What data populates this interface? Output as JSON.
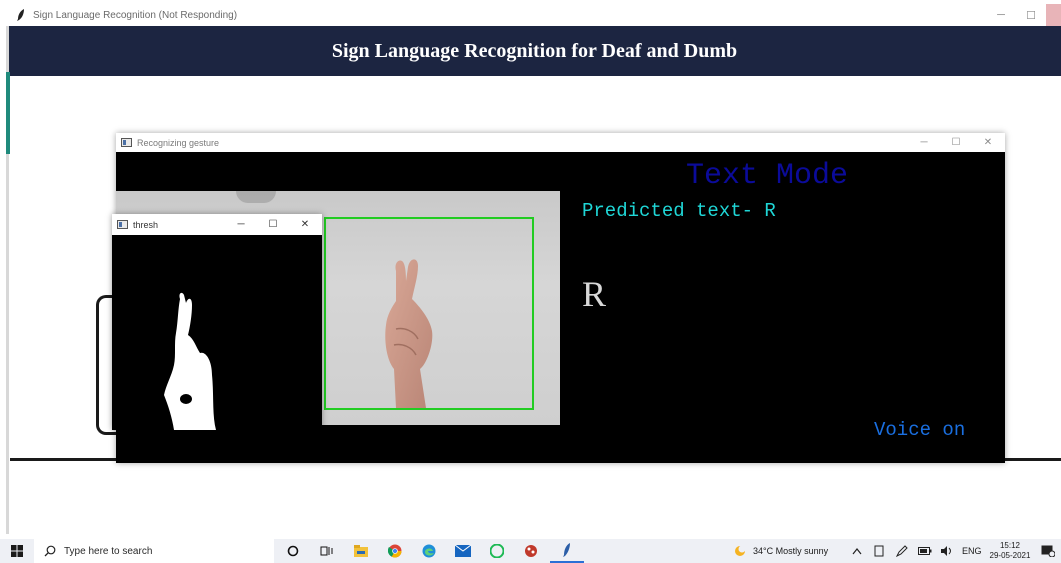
{
  "main_window": {
    "title": "Sign Language Recognition (Not Responding)",
    "minimize_glyph": "─",
    "maximize_glyph": "☐",
    "close_glyph": "✕",
    "banner": "Sign Language Recognition for Deaf and Dumb"
  },
  "recognition_window": {
    "title": "Recognizing gesture",
    "minimize_glyph": "─",
    "maximize_glyph": "☐",
    "close_glyph": "✕",
    "mode_label": "Text Mode",
    "predicted_text": "Predicted text- R",
    "current_letter": "R",
    "voice_status": "Voice on"
  },
  "thresh_window": {
    "title": "thresh",
    "minimize_glyph": "─",
    "maximize_glyph": "☐",
    "close_glyph": "✕"
  },
  "taskbar": {
    "search_placeholder": "Type here to search",
    "pinned_icons": [
      "cortana-icon",
      "task-view-icon",
      "file-explorer-icon",
      "chrome-icon",
      "edge-icon",
      "mail-icon",
      "spotify-icon",
      "game-icon",
      "python-idle-icon"
    ],
    "weather": "34°C  Mostly sunny",
    "language": "ENG",
    "time": "15:12",
    "date": "29-05-2021"
  },
  "colors": {
    "banner_bg": "#1c2541",
    "roi_box": "#22cc22",
    "mode_text": "#0b0b9a",
    "predicted_text": "#1fd6d6",
    "voice_text": "#1a6fe0"
  }
}
